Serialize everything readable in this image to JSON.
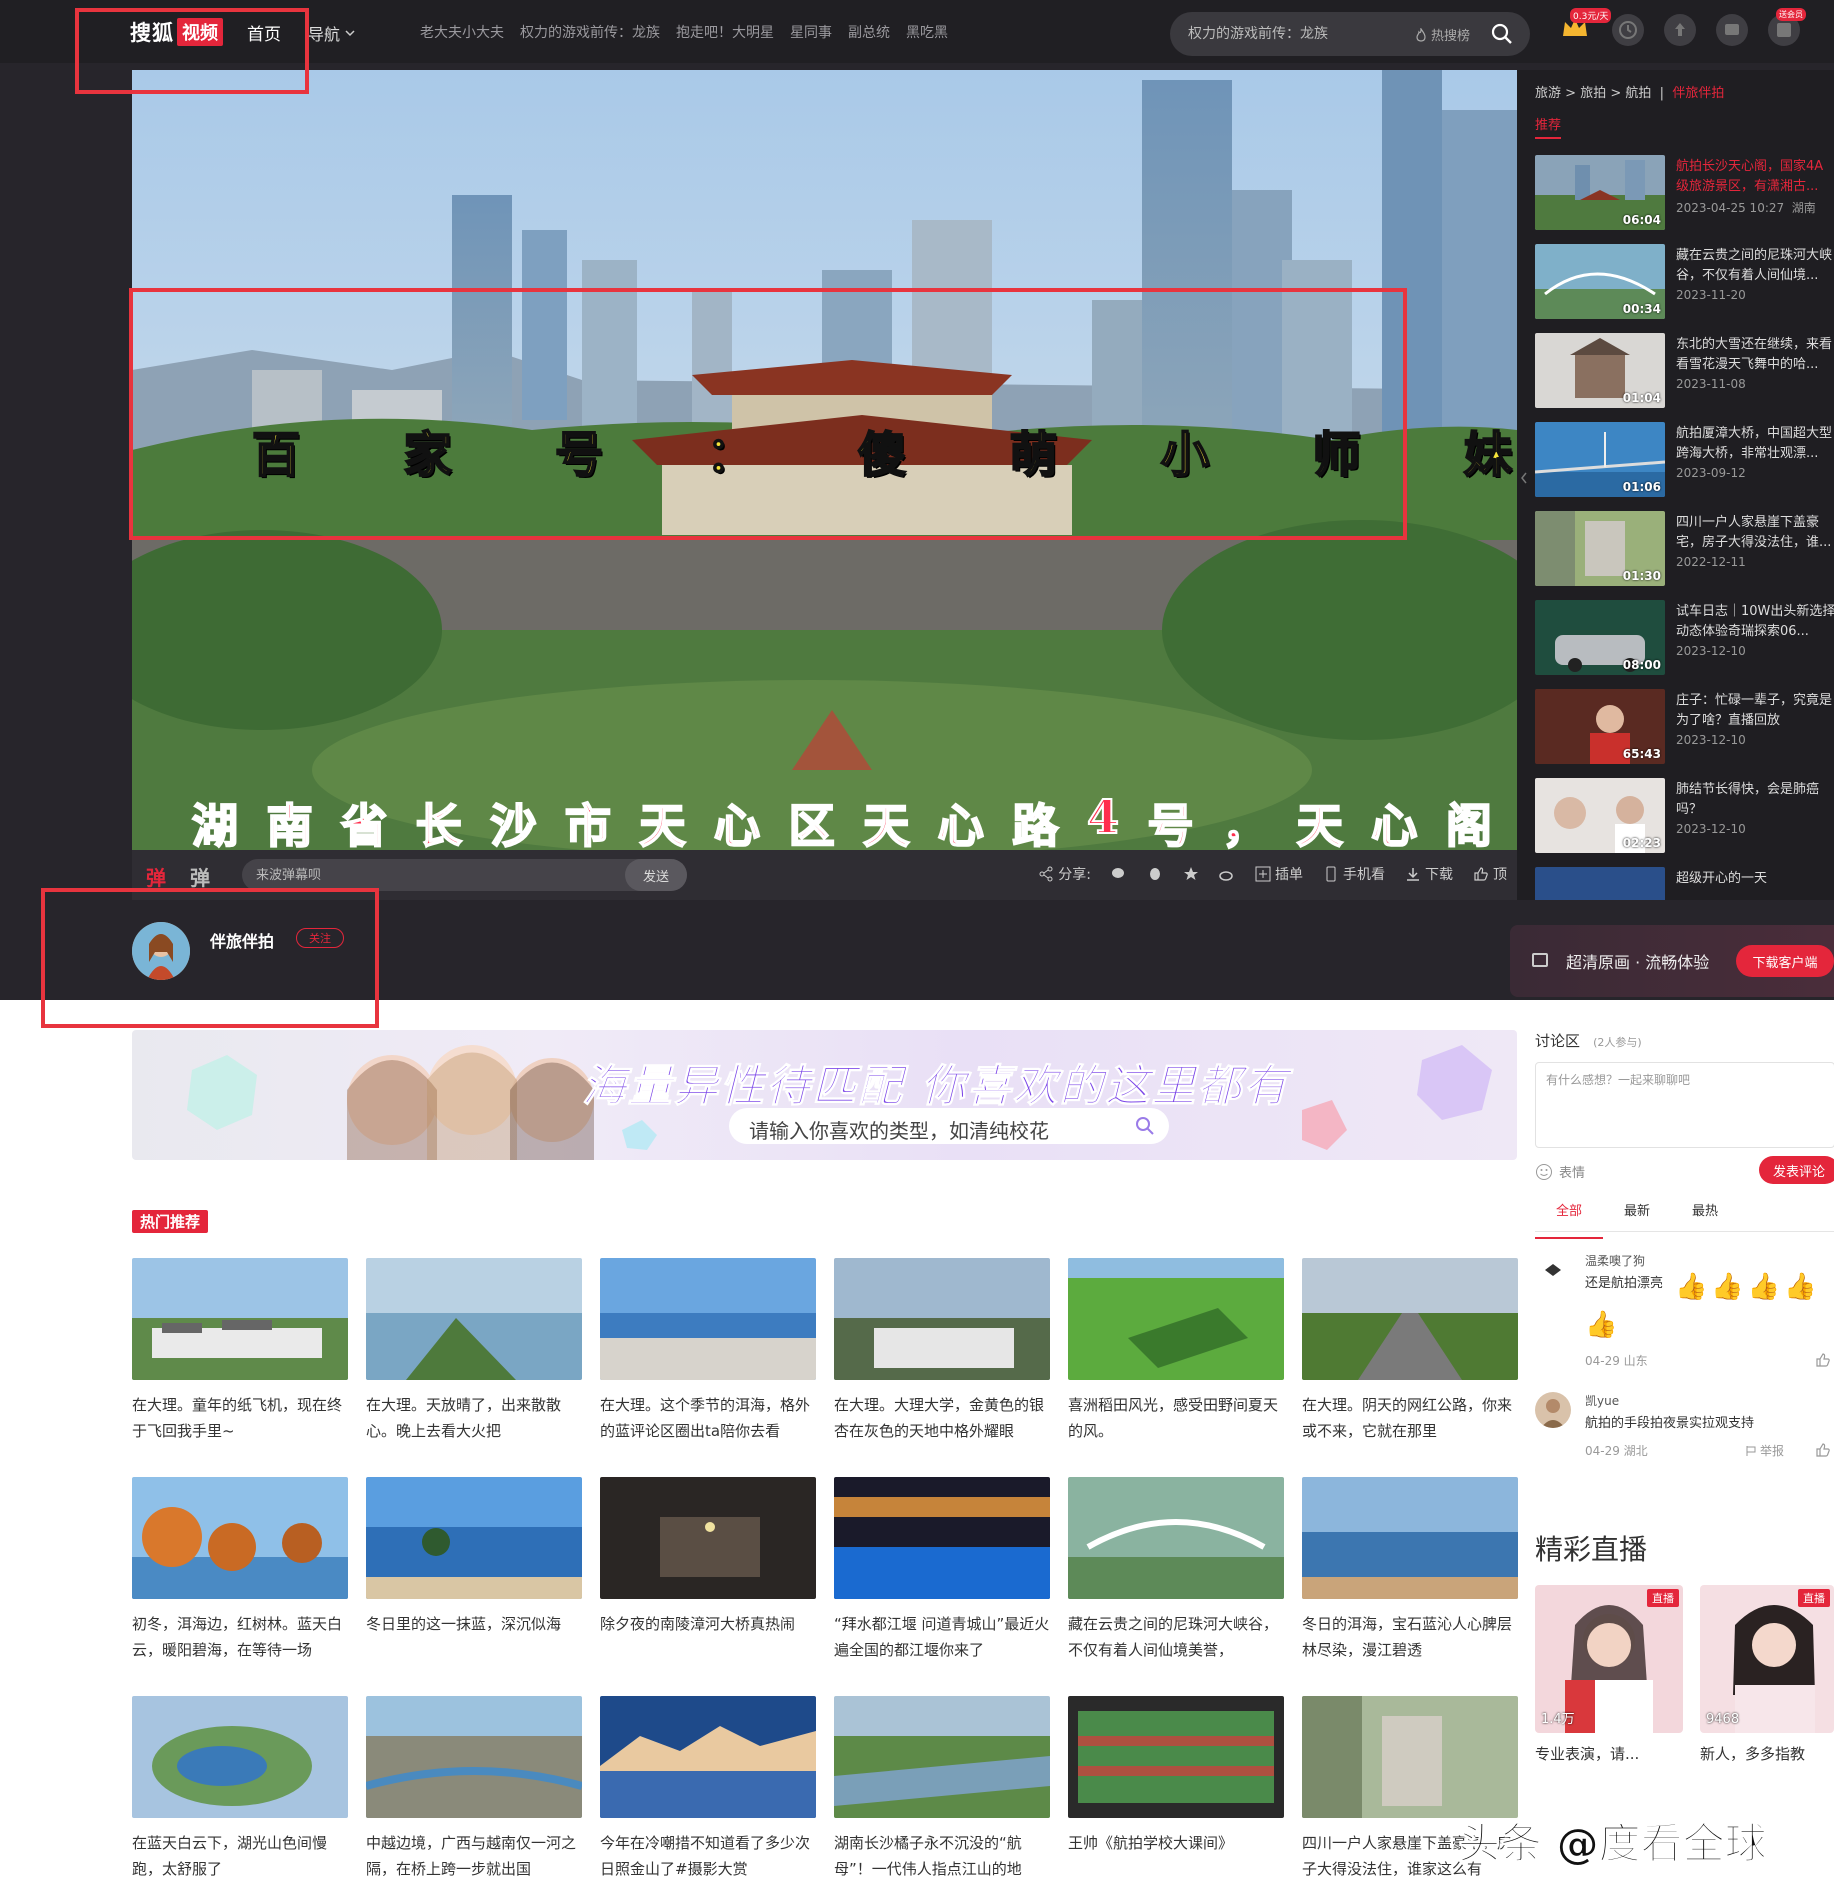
{
  "header": {
    "logo_text": "搜狐",
    "logo_badge": "视频",
    "nav_home": "首页",
    "nav_dao": "导航",
    "hot_links": [
      "老大夫小大夫",
      "权力的游戏前传：龙族",
      "抱走吧！大明星",
      "星同事",
      "副总统",
      "黑吃黑"
    ],
    "search_placeholder": "权力的游戏前传：龙族",
    "hot_search": "热搜榜",
    "vip_price": "0.3元/天",
    "vip_badge": "送会员"
  },
  "player": {
    "caption_top": [
      "百",
      "家",
      "号",
      "：",
      "傻",
      "萌",
      "小",
      "师",
      "妹"
    ],
    "caption_bottom": [
      "湖",
      "南",
      "省",
      "长",
      "沙",
      "市",
      "天",
      "心",
      "区",
      "天",
      "心",
      "路",
      "4",
      "号",
      "，",
      "天",
      "心",
      "阁"
    ],
    "danmu_placeholder": "来波弹幕呗",
    "danmu_send": "发送",
    "controls": {
      "share": "分享:",
      "insert": "插单",
      "mobile": "手机看",
      "download": "下载",
      "like": "顶"
    }
  },
  "recommend": {
    "breadcrumb": [
      "旅游",
      "旅拍",
      "航拍"
    ],
    "breadcrumb_highlight": "伴旅伴拍",
    "tab": "推荐",
    "items": [
      {
        "title": "航拍长沙天心阁，国家4A级旅游景区，有潇湘古...",
        "date": "2023-04-25 10:27",
        "region": "湖南",
        "duration": "06:04",
        "active": true
      },
      {
        "title": "藏在云贵之间的尼珠河大峡谷，不仅有着人间仙境...",
        "date": "2023-11-20",
        "duration": "00:34"
      },
      {
        "title": "东北的大雪还在继续，来看看雪花漫天飞舞中的哈...",
        "date": "2023-11-08",
        "duration": "01:04"
      },
      {
        "title": "航拍厦漳大桥，中国超大型跨海大桥，非常壮观漂...",
        "date": "2023-09-12",
        "duration": "01:06"
      },
      {
        "title": "四川一户人家悬崖下盖豪宅，房子大得没法住，谁...",
        "date": "2022-12-11",
        "duration": "01:30"
      },
      {
        "title": "试车日志｜10W出头新选择 动态体验奇瑞探索06...",
        "date": "2023-12-10",
        "duration": "08:00"
      },
      {
        "title": "庄子：忙碌一辈子，究竟是为了啥？直播回放",
        "date": "2023-12-10",
        "duration": "65:43"
      },
      {
        "title": "肺结节长得快，会是肺癌吗？",
        "date": "2023-12-10",
        "duration": "02:23"
      },
      {
        "title": "超级开心的一天",
        "date": "",
        "duration": ""
      }
    ]
  },
  "author": {
    "name": "伴旅伴拍",
    "follow": "关注"
  },
  "client_banner": {
    "text": "超清原画 · 流畅体验",
    "button": "下载客户端"
  },
  "ad": {
    "title": "海量异性待匹配 你喜欢的这里都有",
    "search_text": "请输入你喜欢的类型，如清纯校花"
  },
  "discussion": {
    "title": "讨论区",
    "count": "(2人参与)",
    "placeholder": "有什么感想？一起来聊聊吧",
    "emoji": "表情",
    "post": "发表评论",
    "tabs": [
      "全部",
      "最新",
      "最热"
    ],
    "comments": [
      {
        "user": "温柔噢了狗",
        "text": "还是航拍漂亮",
        "meta": "04-29 山东"
      },
      {
        "user": "凯yue",
        "text": "航拍的手段拍夜景实拉观支持",
        "meta": "04-29 湖北",
        "report": "举报"
      }
    ]
  },
  "live": {
    "title": "精彩直播",
    "badge": "直播",
    "cards": [
      {
        "count": "1.4万",
        "text": "专业表演，请..."
      },
      {
        "count": "9468",
        "text": "新人，多多指教"
      }
    ]
  },
  "hot": {
    "label": "热门推荐",
    "cards": [
      {
        "title": "在大理。童年的纸飞机，现在终于飞回我手里~"
      },
      {
        "title": "在大理。天放晴了，出来散散心。晚上去看大火把"
      },
      {
        "title": "在大理。这个季节的洱海，格外的蓝评论区圈出ta陪你去看"
      },
      {
        "title": "在大理。大理大学，金黄色的银杏在灰色的天地中格外耀眼"
      },
      {
        "title": "喜洲稻田风光，感受田野间夏天的风。"
      },
      {
        "title": "在大理。阴天的网红公路，你来或不来，它就在那里"
      },
      {
        "title": "初冬，洱海边，红树林。蓝天白云，暖阳碧海，在等待一场"
      },
      {
        "title": "冬日里的这一抹蓝，深沉似海"
      },
      {
        "title": "除夕夜的南陵漳河大桥真热闹"
      },
      {
        "title": "“拜水都江堰 问道青城山”最近火遍全国的都江堰你来了"
      },
      {
        "title": "藏在云贵之间的尼珠河大峡谷，不仅有着人间仙境美誉，"
      },
      {
        "title": "冬日的洱海，宝石蓝沁人心脾层林尽染，漫江碧透"
      },
      {
        "title": "在蓝天白云下，湖光山色间慢跑，太舒服了"
      },
      {
        "title": "中越边境，广西与越南仅一河之隔，在桥上跨一步就出国"
      },
      {
        "title": "今年在冷嘲措不知道看了多少次日照金山了#摄影大赏"
      },
      {
        "title": "湖南长沙橘子永不沉没的“航母”！一代伟人指点江山的地"
      },
      {
        "title": "王帅《航拍学校大课间》"
      },
      {
        "title": "四川一户人家悬崖下盖豪宅，房子大得没法住，谁家这么有"
      }
    ]
  },
  "watermark": "头条 @度看全球"
}
